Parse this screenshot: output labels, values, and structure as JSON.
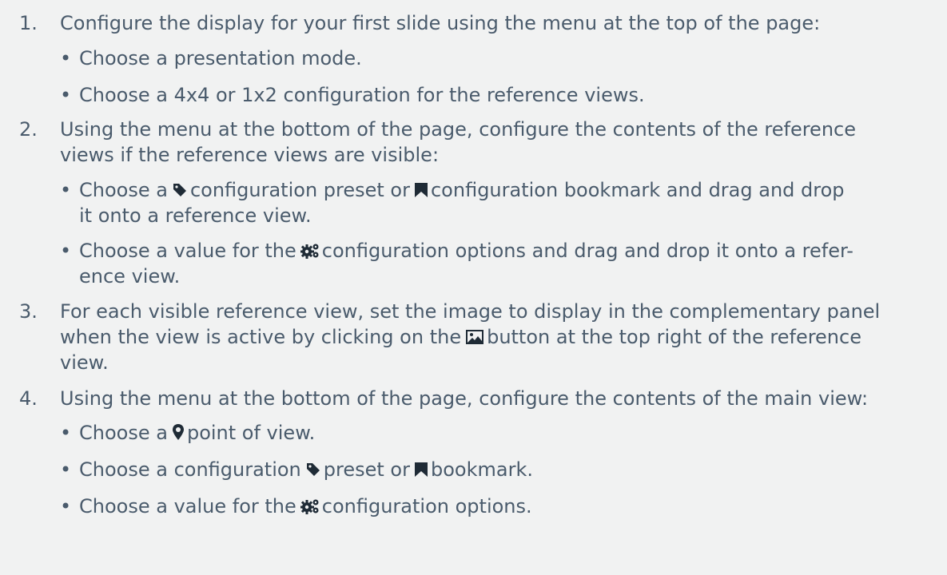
{
  "steps": [
    {
      "number": "1.",
      "text": "Configure the display for your first slide using the menu at the top of the page:",
      "bullets": [
        {
          "text": "Choose a presentation mode."
        },
        {
          "text": "Choose a 4x4 or 1x2 configuration for the reference views."
        }
      ]
    },
    {
      "number": "2.",
      "lines": [
        "Using the menu at the bottom of the page, configure the contents of the reference",
        "views if the reference views are visible:"
      ],
      "bullets": [
        {
          "a": "Choose a",
          "icon1": "tag-icon",
          "b": "configuration preset or",
          "icon2": "bookmark-icon",
          "c": "configuration bookmark and drag and drop",
          "d": "it onto a reference view."
        },
        {
          "a": "Choose a value for the",
          "icon1": "cogs-icon",
          "b": "configuration options and drag and drop it onto a refer-",
          "c": "ence view."
        }
      ]
    },
    {
      "number": "3.",
      "lines": [
        "For each visible reference view, set the image to display in the complementary panel"
      ],
      "line2a": "when the view is active by clicking on the",
      "line2icon": "image-icon",
      "line2b": "button at the top right of the reference",
      "line3": "view."
    },
    {
      "number": "4.",
      "text": "Using the menu at the bottom of the page, configure the contents of the main view:",
      "bullets": [
        {
          "a": "Choose a",
          "icon1": "map-marker-icon",
          "b": "point of view."
        },
        {
          "a": "Choose a configuration",
          "icon1": "tag-icon",
          "b": "preset or",
          "icon2": "bookmark-icon",
          "c": "bookmark."
        },
        {
          "a": "Choose a value for the",
          "icon1": "cogs-icon",
          "b": "configuration options."
        }
      ]
    }
  ],
  "bullet_char": "•",
  "colors": {
    "text": "#4a5b6c",
    "background": "#f1f2f2",
    "icon": "#1f2b36",
    "accent_red": "#e0191d"
  }
}
